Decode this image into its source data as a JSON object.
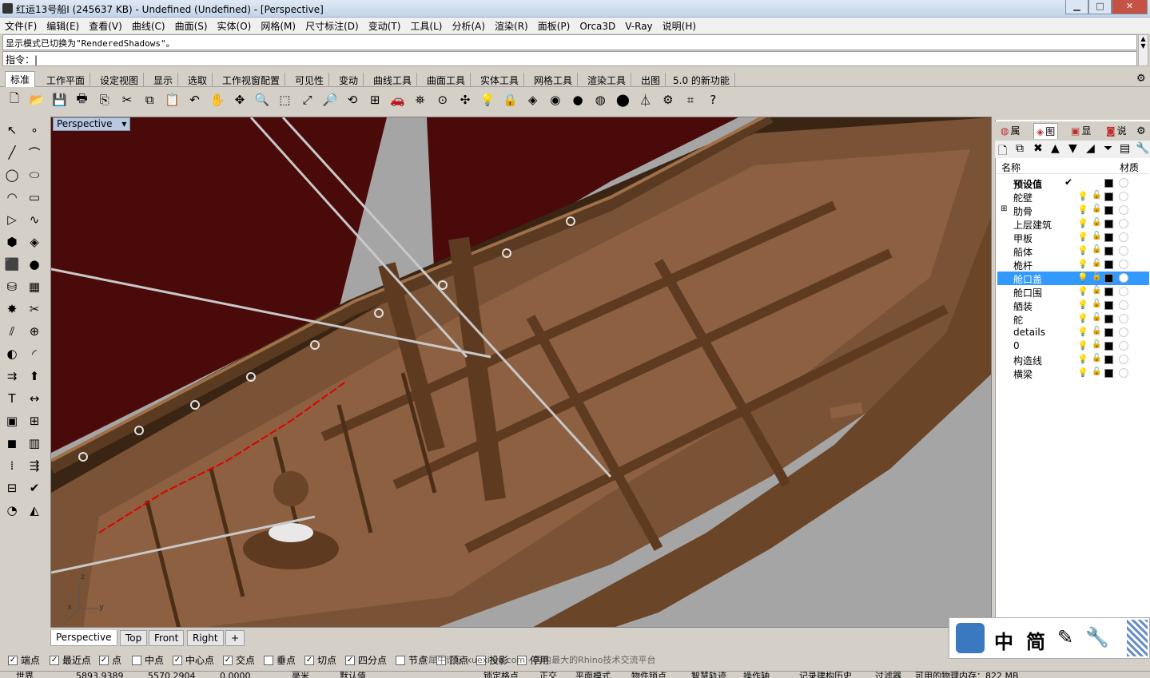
{
  "window": {
    "title": "红运13号船I (245637 KB) - Undefined (Undefined) - [Perspective]",
    "min_glyph": "▁",
    "max_glyph": "□",
    "close_glyph": "✕"
  },
  "menu": [
    "文件(F)",
    "编辑(E)",
    "查看(V)",
    "曲线(C)",
    "曲面(S)",
    "实体(O)",
    "网格(M)",
    "尺寸标注(D)",
    "变动(T)",
    "工具(L)",
    "分析(A)",
    "渲染(R)",
    "面板(P)",
    "Orca3D",
    "V-Ray",
    "说明(H)"
  ],
  "command": {
    "history": "显示模式已切换为\"RenderedShadows\"。",
    "prompt": "指令：",
    "value": "|"
  },
  "toolbar_tabs": [
    "标准",
    "工作平面",
    "设定视图",
    "显示",
    "选取",
    "工作视窗配置",
    "可见性",
    "变动",
    "曲线工具",
    "曲面工具",
    "实体工具",
    "网格工具",
    "渲染工具",
    "出图",
    "5.0 的新功能"
  ],
  "main_toolbar_icons": [
    "new-icon",
    "open-icon",
    "save-icon",
    "print-icon",
    "import-icon",
    "cut-icon",
    "copy-icon",
    "paste-icon",
    "undo-icon",
    "pan-icon",
    "move-view-icon",
    "zoom-icon",
    "zoom-window-icon",
    "zoom-extents-icon",
    "zoom-selected-icon",
    "rotate-view-icon",
    "four-view-icon",
    "car-icon",
    "named-view-icon",
    "cplane-icon",
    "osnap-icon",
    "light-icon",
    "lock-icon",
    "layer-icon",
    "color-icon",
    "material-icon",
    "render-preview-icon",
    "render-icon",
    "filter-icon",
    "options-icon",
    "grid-icon",
    "help-icon"
  ],
  "viewport": {
    "name": "Perspective",
    "dropdown": "▾",
    "axis_z": "z",
    "axis_x": "x",
    "axis_y": "y"
  },
  "viewport_tabs": [
    "Perspective",
    "Top",
    "Front",
    "Right",
    "+"
  ],
  "osnaps": [
    {
      "label": "端点",
      "checked": true
    },
    {
      "label": "最近点",
      "checked": true
    },
    {
      "label": "点",
      "checked": true
    },
    {
      "label": "中点",
      "checked": false
    },
    {
      "label": "中心点",
      "checked": true
    },
    {
      "label": "交点",
      "checked": true
    },
    {
      "label": "垂点",
      "checked": false
    },
    {
      "label": "切点",
      "checked": true
    },
    {
      "label": "四分点",
      "checked": true
    },
    {
      "label": "节点",
      "checked": false
    },
    {
      "label": "顶点",
      "checked": false
    },
    {
      "label": "投影",
      "checked": false
    },
    {
      "label": "停用",
      "checked": false
    }
  ],
  "watermark": "学犀牛论坛 xuexiniu.com  - 国内最大的Rhino技术交流平台",
  "status": [
    "世界",
    "5893.9389",
    "5570.2904",
    "0.0000",
    "毫米",
    "默认值",
    "锁定格点",
    "正交",
    "平面模式",
    "物件锁点",
    "智慧轨迹",
    "操作轴",
    "记录建构历史",
    "过滤器",
    "可用的物理内存：822 MB"
  ],
  "panel_tabs": [
    "属",
    "图",
    "显",
    "说"
  ],
  "layers_header": {
    "name": "名称",
    "material": "材质"
  },
  "layers": [
    {
      "name": "预设值",
      "current": true,
      "bold": true
    },
    {
      "name": "舵壁"
    },
    {
      "name": "肋骨",
      "expand": "⊞"
    },
    {
      "name": "上层建筑"
    },
    {
      "name": "甲板"
    },
    {
      "name": "船体"
    },
    {
      "name": "桅杆"
    },
    {
      "name": "舱口盖",
      "selected": true
    },
    {
      "name": "舱口围"
    },
    {
      "name": "舾装"
    },
    {
      "name": "舵"
    },
    {
      "name": "details"
    },
    {
      "name": "0"
    },
    {
      "name": "构造线"
    },
    {
      "name": "横梁"
    }
  ],
  "logo_chars": [
    "中",
    "简"
  ],
  "colors": {
    "sail": "#4a0a0a",
    "wood": "#7a5235",
    "deck": "#8c6040",
    "viewport_bg": "#a5a5a5",
    "selection": "#3399ff"
  }
}
